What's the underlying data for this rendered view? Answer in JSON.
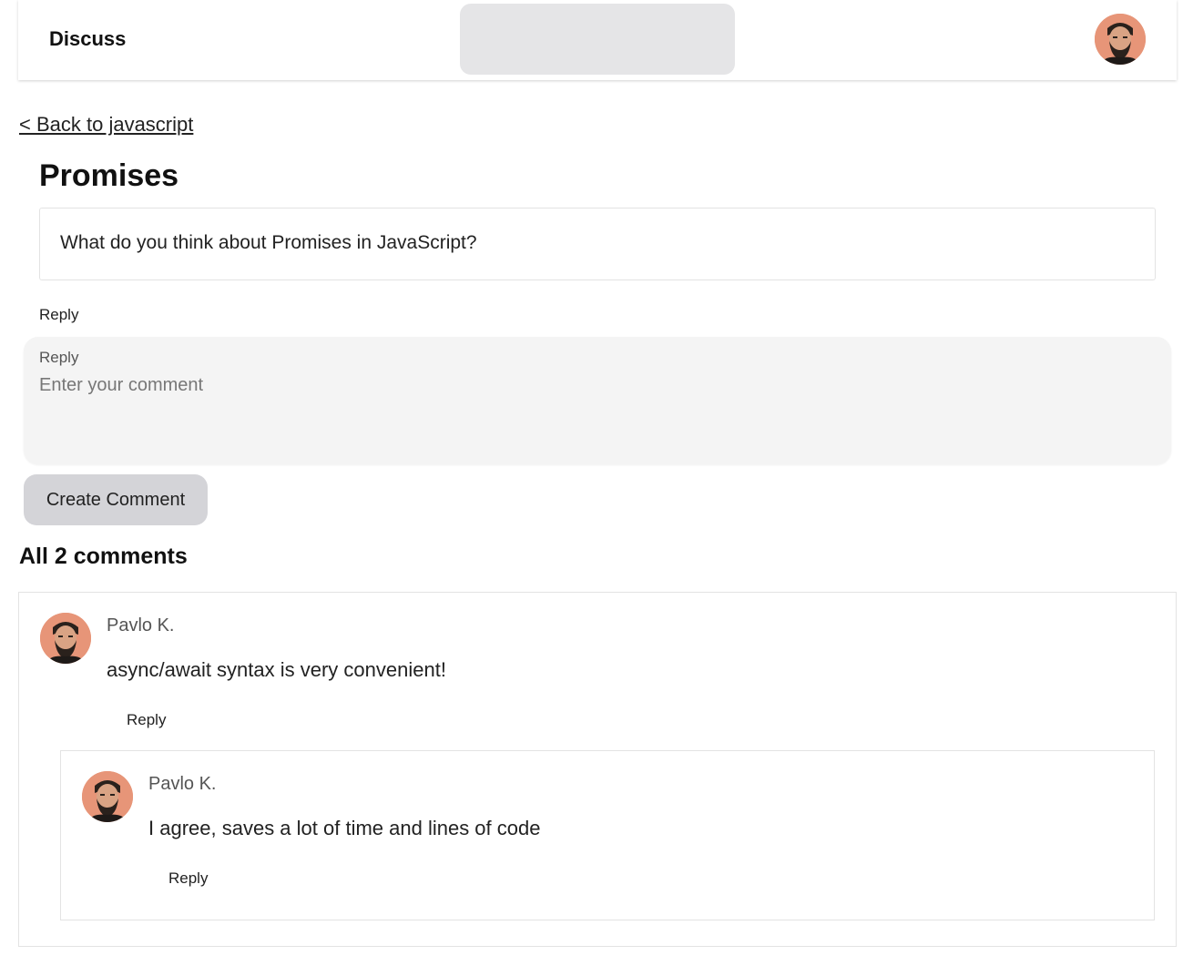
{
  "header": {
    "brand": "Discuss",
    "user_avatar_icon": "user-avatar"
  },
  "nav": {
    "back_label": "< Back to javascript"
  },
  "post": {
    "title": "Promises",
    "body": "What do you think about Promises in JavaScript?",
    "reply_label": "Reply"
  },
  "composer": {
    "label": "Reply",
    "placeholder": "Enter your comment",
    "value": "",
    "submit_label": "Create Comment"
  },
  "comments": {
    "heading": "All 2 comments",
    "items": [
      {
        "author": "Pavlo K.",
        "text": "async/await syntax is very convenient!",
        "reply_label": "Reply",
        "replies": [
          {
            "author": "Pavlo K.",
            "text": "I agree, saves a lot of time and lines of code",
            "reply_label": "Reply"
          }
        ]
      }
    ]
  },
  "colors": {
    "avatar_bg": "#e79578",
    "search_bg": "#e5e5e7",
    "composer_bg": "#f4f4f4",
    "button_bg": "#d4d4d8",
    "border": "#e3e3e3"
  }
}
